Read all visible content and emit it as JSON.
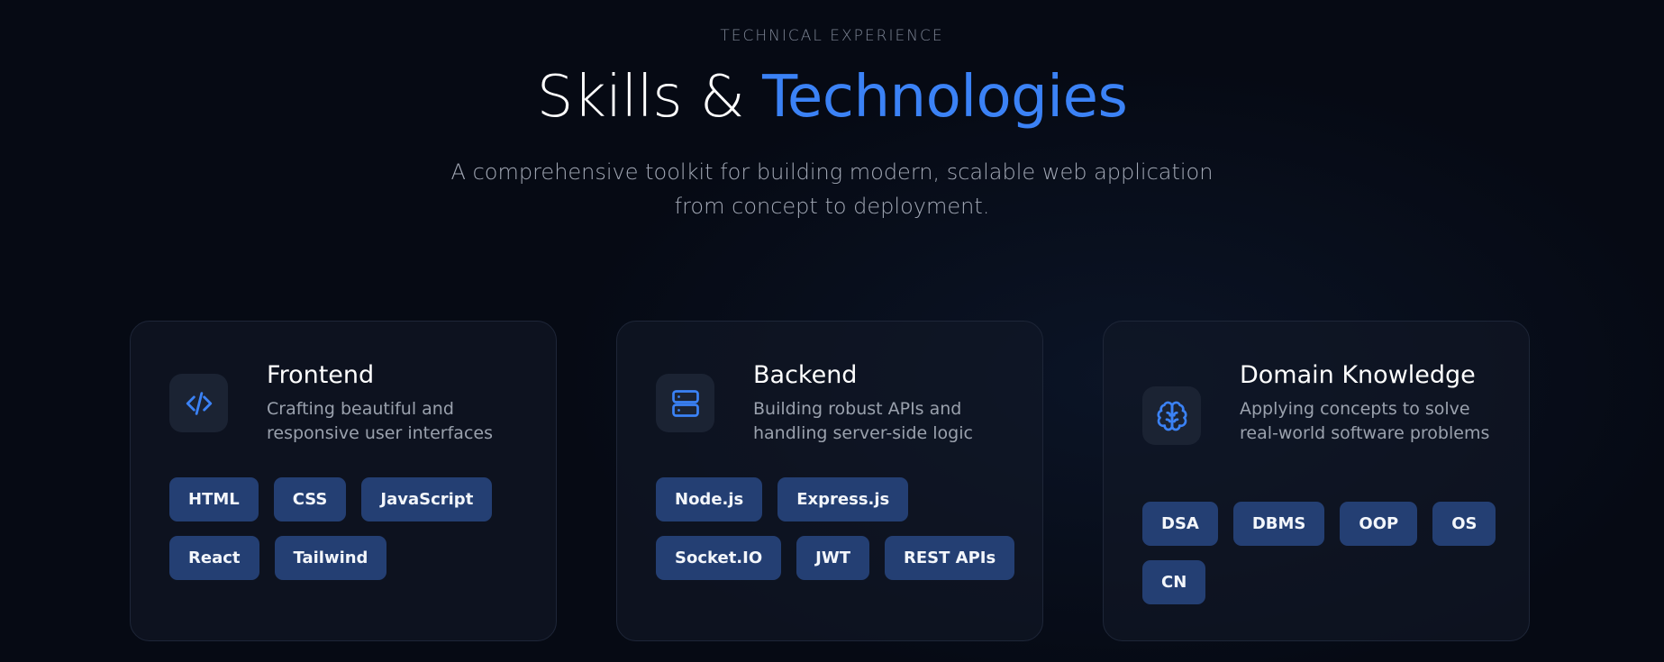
{
  "header": {
    "eyebrow": "TECHNICAL EXPERIENCE",
    "title_plain": "Skills & ",
    "title_accent": "Technologies",
    "subtitle_line1": "A comprehensive toolkit for building modern, scalable web application",
    "subtitle_line2": "from concept to deployment."
  },
  "colors": {
    "accent": "#3b82f6",
    "background": "#060a14",
    "card_background": "#0f1524",
    "tag_background": "#243f73"
  },
  "cards": [
    {
      "icon": "code-icon",
      "title": "Frontend",
      "description": "Crafting beautiful and responsive user interfaces",
      "tags": [
        "HTML",
        "CSS",
        "JavaScript",
        "React",
        "Tailwind"
      ]
    },
    {
      "icon": "server-icon",
      "title": "Backend",
      "description": "Building robust APIs and handling server-side logic",
      "tags": [
        "Node.js",
        "Express.js",
        "Socket.IO",
        "JWT",
        "REST APIs"
      ]
    },
    {
      "icon": "brain-icon",
      "title": "Domain Knowledge",
      "description": "Applying concepts to solve real-world software problems",
      "tags": [
        "DSA",
        "DBMS",
        "OOP",
        "OS",
        "CN"
      ]
    }
  ]
}
